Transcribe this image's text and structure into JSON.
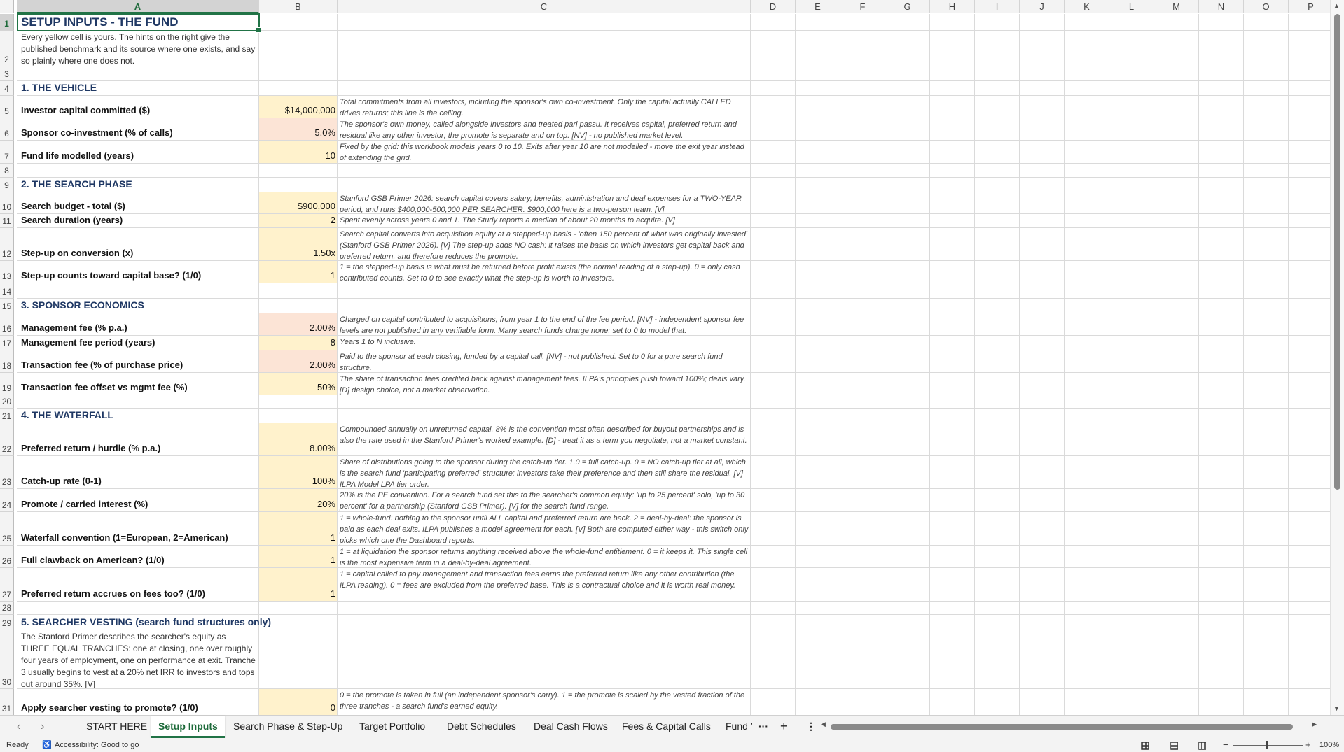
{
  "columns": [
    "A",
    "B",
    "C",
    "D",
    "E",
    "F",
    "G",
    "H",
    "I",
    "J",
    "K",
    "L",
    "M",
    "N",
    "O",
    "P"
  ],
  "title": "SETUP INPUTS - THE FUND",
  "intro": "Every yellow cell is yours. The hints on the right give the published benchmark and its source where one exists, and say so plainly where one does not.",
  "rows": {
    "r4": {
      "section": "1. THE VEHICLE"
    },
    "r5": {
      "label": "Investor capital committed ($)",
      "value": "$14,000,000",
      "hint": "Total commitments from all investors, including the sponsor's own co-investment. Only the capital actually CALLED drives returns; this line is the ceiling."
    },
    "r6": {
      "label": "Sponsor co-investment (% of calls)",
      "value": "5.0%",
      "hint": "The sponsor's own money, called alongside investors and treated pari passu. It receives capital, preferred return and residual like any other investor; the promote is separate and on top. [NV] - no published market level."
    },
    "r7": {
      "label": "Fund life modelled (years)",
      "value": "10",
      "hint": "Fixed by the grid: this workbook models years 0 to 10. Exits after year 10 are not modelled - move the exit year instead of extending the grid."
    },
    "r9": {
      "section": "2. THE SEARCH PHASE"
    },
    "r10": {
      "label": "Search budget - total ($)",
      "value": "$900,000",
      "hint": "Stanford GSB Primer 2026: search capital covers salary, benefits, administration and deal expenses for a TWO-YEAR period, and runs $400,000-500,000 PER SEARCHER. $900,000 here is a two-person team. [V]"
    },
    "r11": {
      "label": "Search duration (years)",
      "value": "2",
      "hint": "Spent evenly across years 0 and 1. The Study reports a median of about 20 months to acquire. [V]"
    },
    "r12": {
      "label": "Step-up on conversion (x)",
      "value": "1.50x",
      "hint": "Search capital converts into acquisition equity at a stepped-up basis - 'often 150 percent of what was originally invested' (Stanford GSB Primer 2026). [V] The step-up adds NO cash: it raises the basis on which investors get capital back and preferred return, and therefore reduces the promote."
    },
    "r13": {
      "label": "Step-up counts toward capital base? (1/0)",
      "value": "1",
      "hint": "1 = the stepped-up basis is what must be returned before profit exists (the normal reading of a step-up). 0 = only cash contributed counts. Set to 0 to see exactly what the step-up is worth to investors."
    },
    "r15": {
      "section": "3. SPONSOR ECONOMICS"
    },
    "r16": {
      "label": "Management fee (% p.a.)",
      "value": "2.00%",
      "hint": "Charged on capital contributed to acquisitions, from year 1 to the end of the fee period. [NV] - independent sponsor fee levels are not published in any verifiable form. Many search funds charge none: set to 0 to model that."
    },
    "r17": {
      "label": "Management fee period (years)",
      "value": "8",
      "hint": "Years 1 to N inclusive."
    },
    "r18": {
      "label": "Transaction fee (% of purchase price)",
      "value": "2.00%",
      "hint": "Paid to the sponsor at each closing, funded by a capital call. [NV] - not published. Set to 0 for a pure search fund structure."
    },
    "r19": {
      "label": "Transaction fee offset vs mgmt fee (%)",
      "value": "50%",
      "hint": "The share of transaction fees credited back against management fees. ILPA's principles push toward 100%; deals vary. [D] design choice, not a market observation."
    },
    "r21": {
      "section": "4. THE WATERFALL"
    },
    "r22": {
      "label": "Preferred return / hurdle (% p.a.)",
      "value": "8.00%",
      "hint": "Compounded annually on unreturned capital. 8% is the convention most often described for buyout partnerships and is also the rate used in the Stanford Primer's worked example. [D] - treat it as a term you negotiate, not a market constant."
    },
    "r23": {
      "label": "Catch-up rate (0-1)",
      "value": "100%",
      "hint": "Share of distributions going to the sponsor during the catch-up tier. 1.0 = full catch-up. 0 = NO catch-up tier at all, which is the search fund 'participating preferred' structure: investors take their preference and then still share the residual. [V] ILPA Model LPA tier order."
    },
    "r24": {
      "label": "Promote / carried interest (%)",
      "value": "20%",
      "hint": "20% is the PE convention. For a search fund set this to the searcher's common equity: 'up to 25 percent' solo, 'up to 30 percent' for a partnership (Stanford GSB Primer). [V] for the search fund range."
    },
    "r25": {
      "label": "Waterfall convention (1=European, 2=American)",
      "value": "1",
      "hint": "1 = whole-fund: nothing to the sponsor until ALL capital and preferred return are back. 2 = deal-by-deal: the sponsor is paid as each deal exits. ILPA publishes a model agreement for each. [V] Both are computed either way - this switch only picks which one the Dashboard reports."
    },
    "r26": {
      "label": "Full clawback on American? (1/0)",
      "value": "1",
      "hint": "1 = at liquidation the sponsor returns anything received above the whole-fund entitlement. 0 = it keeps it. This single cell is the most expensive term in a deal-by-deal agreement."
    },
    "r27": {
      "label": "Preferred return accrues on fees too? (1/0)",
      "value": "1",
      "hint": "1 = capital called to pay management and transaction fees earns the preferred return like any other contribution (the ILPA reading). 0 = fees are excluded from the preferred base. This is a contractual choice and it is worth real money."
    },
    "r29": {
      "section": "5. SEARCHER VESTING (search fund structures only)"
    },
    "r30": {
      "intro": "The Stanford Primer describes the searcher's equity as THREE EQUAL TRANCHES: one at closing, one over roughly four years of employment, one on performance at exit. Tranche 3 usually begins to vest at a 20% net IRR to investors and tops out around 35%. [V]"
    },
    "r31": {
      "label": "Apply searcher vesting to promote? (1/0)",
      "value": "0",
      "hint": "0 = the promote is taken in full (an independent sponsor's carry). 1 = the promote is scaled by the vested fraction of the three tranches - a search fund's earned equity."
    }
  },
  "tabs": [
    "START HERE",
    "Setup Inputs",
    "Search Phase & Step-Up",
    "Target Portfolio",
    "Debt Schedules",
    "Deal Cash Flows",
    "Fees & Capital Calls",
    "Fund ’"
  ],
  "active_tab": "Setup Inputs",
  "status": {
    "ready": "Ready",
    "accessibility": "Accessibility: Good to go",
    "zoom": "100%"
  },
  "colors": {
    "input_yellow": "#fff2cc",
    "input_pink": "#fce4d6",
    "heading_blue": "#1f3864",
    "excel_green": "#217346"
  }
}
